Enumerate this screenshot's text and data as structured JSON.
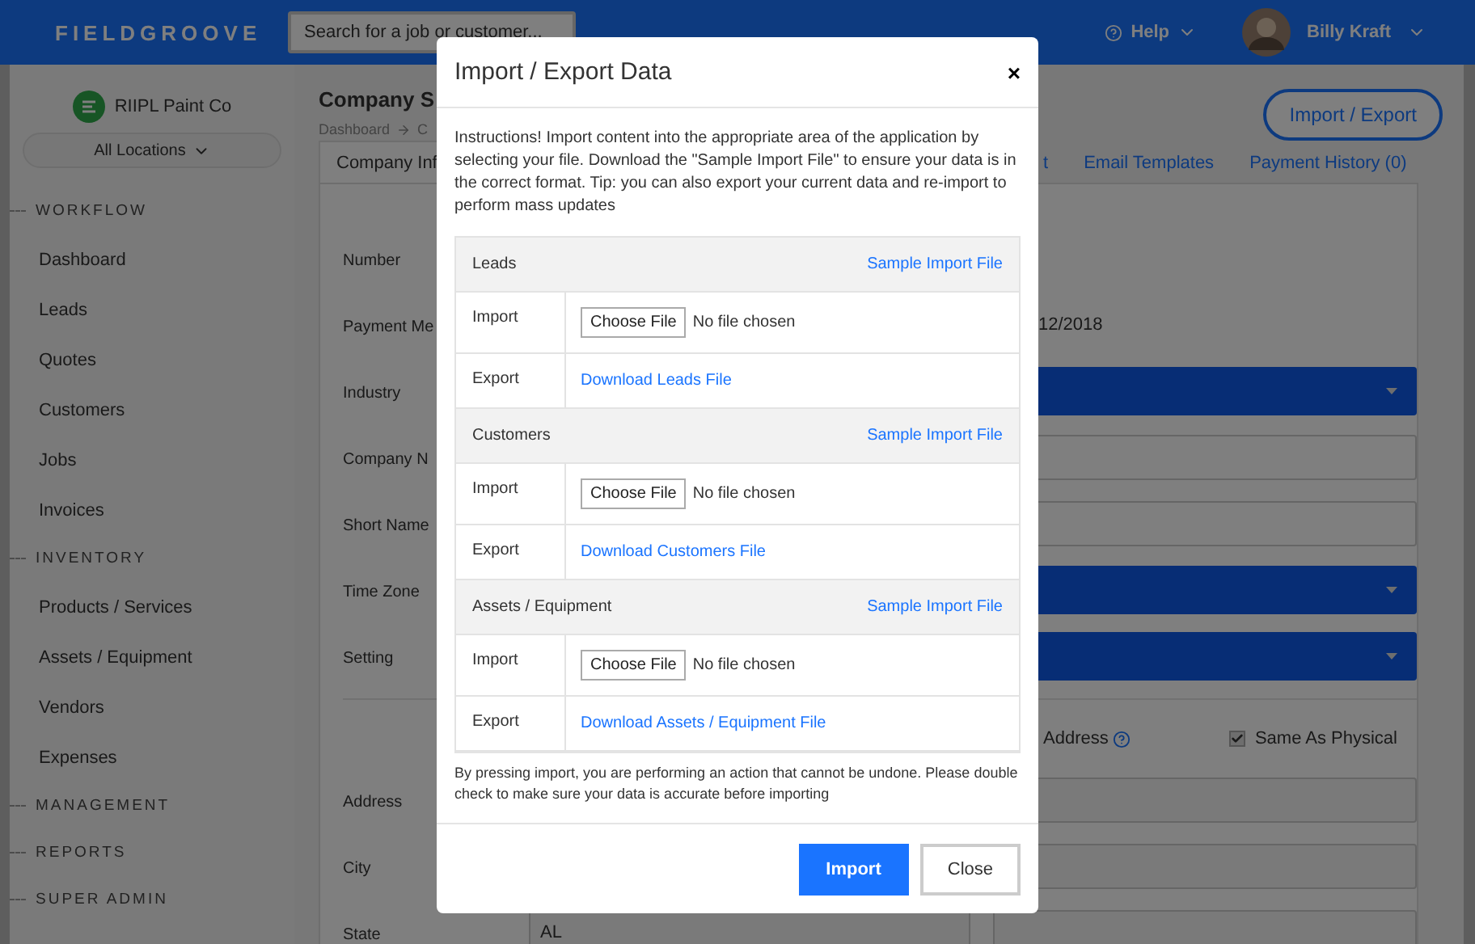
{
  "topbar": {
    "logo": "FIELDGROOVE",
    "search": {
      "placeholder": "Search for a job or customer..."
    },
    "help": "Help",
    "user": "Billy Kraft"
  },
  "sidebar": {
    "company": "RIIPL Paint Co",
    "location": "All Locations",
    "sections": [
      {
        "title": "WORKFLOW",
        "items": [
          "Dashboard",
          "Leads",
          "Quotes",
          "Customers",
          "Jobs",
          "Invoices"
        ]
      },
      {
        "title": "INVENTORY",
        "items": [
          "Products / Services",
          "Assets / Equipment",
          "Vendors",
          "Expenses"
        ]
      },
      {
        "title": "MANAGEMENT"
      },
      {
        "title": "REPORTS"
      },
      {
        "title": "SUPER ADMIN"
      }
    ]
  },
  "page": {
    "title": "Company S",
    "breadcrumb": [
      "Dashboard",
      "C"
    ],
    "action": "Import / Export",
    "tabs": [
      {
        "label": "Company Inf",
        "selected": true
      },
      {
        "label": "t",
        "selected": false
      },
      {
        "label": "Email Templates",
        "selected": false
      },
      {
        "label": "Payment History (0)",
        "selected": false
      }
    ],
    "form": [
      {
        "label": "Number",
        "kind": "none"
      },
      {
        "label": "Payment Me",
        "kind": "text",
        "value": "12/2018"
      },
      {
        "label": "Industry",
        "kind": "select"
      },
      {
        "label": "Company N",
        "kind": "input"
      },
      {
        "label": "Short Name",
        "kind": "input"
      },
      {
        "label": "Time Zone",
        "kind": "select"
      },
      {
        "label": "Setting",
        "kind": "select"
      }
    ],
    "mailing": {
      "label": "Address",
      "same_as_physical": {
        "label": "Same As Physical",
        "checked": true
      }
    },
    "address_rows": [
      {
        "label": "Address"
      },
      {
        "label": "City"
      },
      {
        "label": "State",
        "value": "AL"
      }
    ]
  },
  "dialog": {
    "title": "Import / Export Data",
    "close": "×",
    "instructions": "Instructions! Import content into the appropriate area of the application by selecting your file. Download the \"Sample Import File\" to ensure your data is in the correct format. Tip: you can also export your current data and re-import to perform mass updates",
    "sections": [
      {
        "title": "Leads",
        "sample": "Sample Import File",
        "import_label": "Import",
        "choose": "Choose File",
        "no_file": "No file chosen",
        "export_label": "Export",
        "download": "Download Leads File"
      },
      {
        "title": "Customers",
        "sample": "Sample Import File",
        "import_label": "Import",
        "choose": "Choose File",
        "no_file": "No file chosen",
        "export_label": "Export",
        "download": "Download Customers File"
      },
      {
        "title": "Assets / Equipment",
        "sample": "Sample Import File",
        "import_label": "Import",
        "choose": "Choose File",
        "no_file": "No file chosen",
        "export_label": "Export",
        "download": "Download Assets / Equipment File"
      }
    ],
    "warning": "By pressing import, you are performing an action that cannot be undone. Please double check to make sure your data is accurate before importing",
    "buttons": [
      {
        "label": "Import",
        "kind": "primary"
      },
      {
        "label": "Close",
        "kind": "secondary"
      }
    ]
  }
}
